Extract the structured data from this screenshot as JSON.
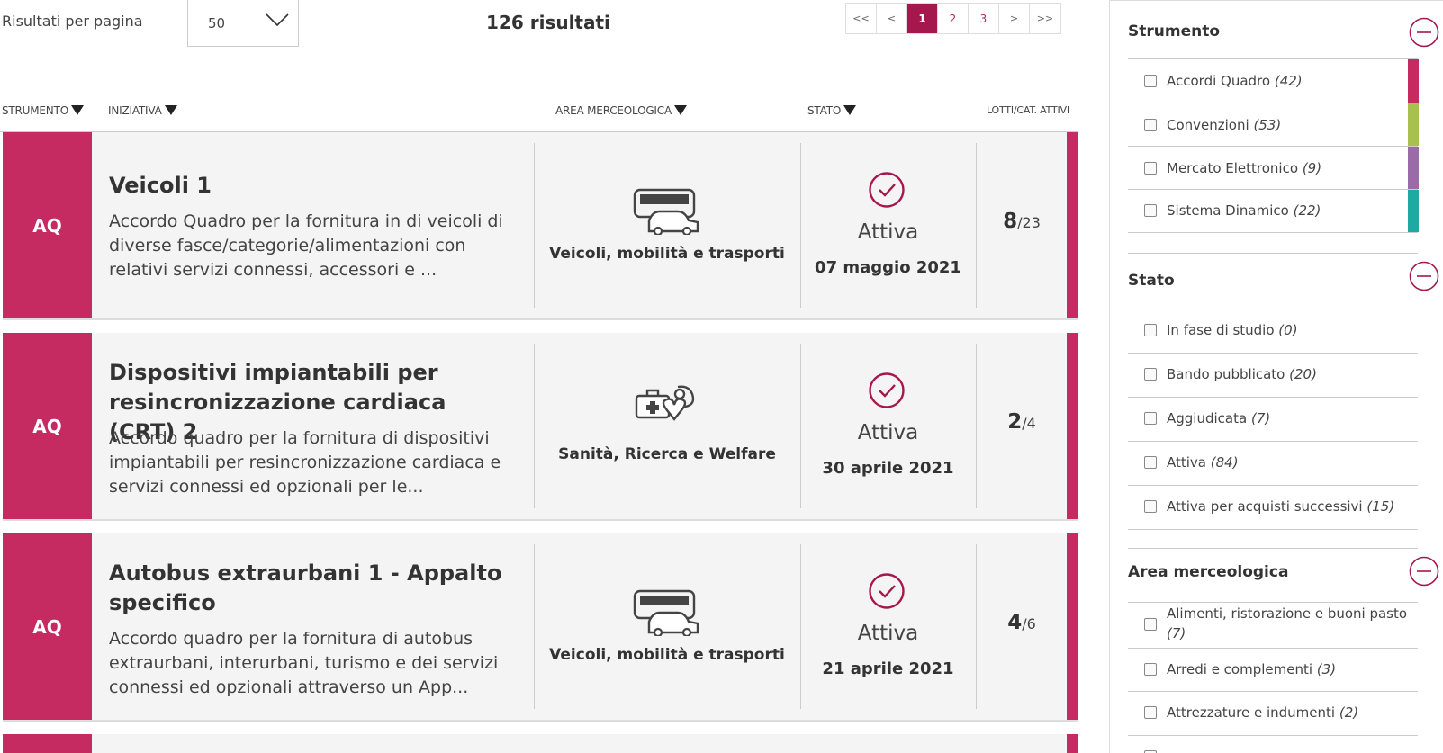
{
  "toolbar": {
    "rpp_label": "Risultati per pagina",
    "rpp_value": "50",
    "total": "126 risultati",
    "pages": [
      "<<",
      "<",
      "1",
      "2",
      "3",
      ">",
      ">>"
    ],
    "active_page": "1"
  },
  "columns": {
    "strumento": "STRUMENTO",
    "iniziativa": "INIZIATIVA",
    "area": "AREA MERCEOLOGICA",
    "stato": "STATO",
    "lotti": "LOTTI/CAT. ATTIVI"
  },
  "results": [
    {
      "badge": "AQ",
      "title": "Veicoli 1",
      "description": "Accordo Quadro per la fornitura in di veicoli di diverse fasce/categorie/alimentazioni con relativi servizi connessi, accessori e ...",
      "area_icon": "bus-car-icon",
      "area": "Veicoli, mobilità e trasporti",
      "stato": "Attiva",
      "date": "07 maggio 2021",
      "lotti_active": "8",
      "lotti_total": "/23"
    },
    {
      "badge": "AQ",
      "title": "Dispositivi impiantabili per resincronizzazione cardiaca (CRT) 2",
      "description": "Accordo quadro per la fornitura di dispositivi impiantabili per resincronizzazione cardiaca e servizi connessi ed opzionali per le...",
      "area_icon": "health-kit-icon",
      "area": "Sanità, Ricerca e Welfare",
      "stato": "Attiva",
      "date": "30 aprile 2021",
      "lotti_active": "2",
      "lotti_total": "/4"
    },
    {
      "badge": "AQ",
      "title": "Autobus extraurbani 1 - Appalto specifico",
      "description": "Accordo quadro per la fornitura di autobus extraurbani, interurbani, turismo e dei servizi connessi ed opzionali attraverso un App...",
      "area_icon": "bus-car-icon",
      "area": "Veicoli, mobilità e trasporti",
      "stato": "Attiva",
      "date": "21 aprile 2021",
      "lotti_active": "4",
      "lotti_total": "/6"
    }
  ],
  "filters": {
    "strumento": {
      "title": "Strumento",
      "items": [
        {
          "label": "Accordi Quadro",
          "count": "(42)",
          "color": "#c52a60"
        },
        {
          "label": "Convenzioni",
          "count": "(53)",
          "color": "#a8c04e"
        },
        {
          "label": "Mercato Elettronico",
          "count": "(9)",
          "color": "#9b6aa8"
        },
        {
          "label": "Sistema Dinamico",
          "count": "(22)",
          "color": "#1fa9a3"
        }
      ]
    },
    "stato": {
      "title": "Stato",
      "items": [
        {
          "label": "In fase di studio",
          "count": "(0)"
        },
        {
          "label": "Bando pubblicato",
          "count": "(20)"
        },
        {
          "label": "Aggiudicata",
          "count": "(7)"
        },
        {
          "label": "Attiva",
          "count": "(84)"
        },
        {
          "label": "Attiva per acquisti successivi",
          "count": "(15)"
        }
      ]
    },
    "area": {
      "title": "Area merceologica",
      "items": [
        {
          "label": "Alimenti, ristorazione e buoni pasto",
          "count": "(7)"
        },
        {
          "label": "Arredi e complementi",
          "count": "(3)"
        },
        {
          "label": "Attrezzature e indumenti",
          "count": "(2)"
        }
      ]
    }
  },
  "colors": {
    "accent": "#c52a60",
    "page_active": "#a4184e"
  }
}
